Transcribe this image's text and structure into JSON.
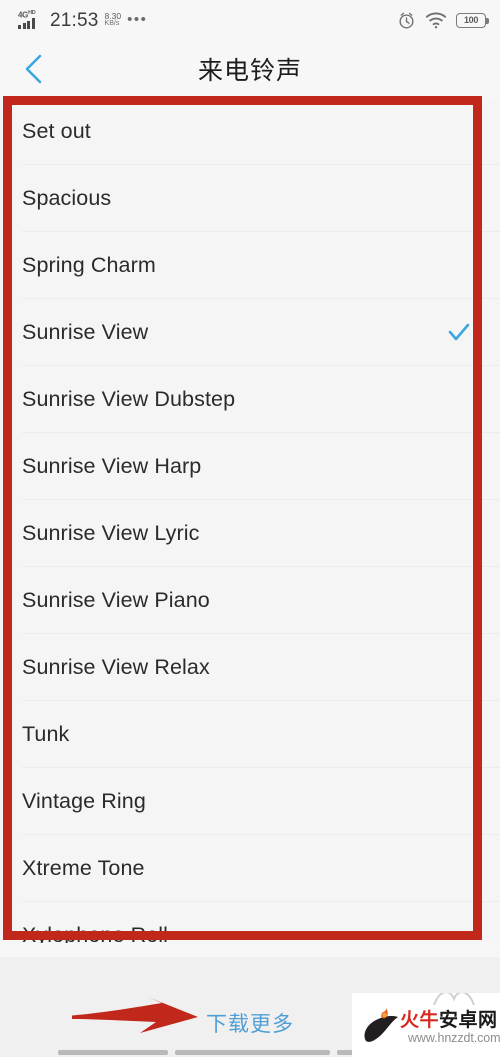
{
  "status_bar": {
    "network_type": "4G",
    "network_suffix": "HD",
    "time": "21:53",
    "net_speed_value": "8.30",
    "net_speed_unit": "KB/s",
    "more_dots": "•••",
    "alarm_icon": "alarm-clock-icon",
    "wifi_icon": "wifi-icon",
    "battery_level": "100"
  },
  "header": {
    "back_icon": "back-chevron-icon",
    "title": "来电铃声"
  },
  "list": {
    "selected": "Sunrise View",
    "check_icon": "checkmark-icon",
    "items": [
      {
        "label": "Set out",
        "checked": false
      },
      {
        "label": "Spacious",
        "checked": false
      },
      {
        "label": "Spring Charm",
        "checked": false
      },
      {
        "label": "Sunrise View",
        "checked": true
      },
      {
        "label": "Sunrise View Dubstep",
        "checked": false
      },
      {
        "label": "Sunrise View Harp",
        "checked": false
      },
      {
        "label": "Sunrise View Lyric",
        "checked": false
      },
      {
        "label": "Sunrise View Piano",
        "checked": false
      },
      {
        "label": "Sunrise View Relax",
        "checked": false
      },
      {
        "label": "Tunk",
        "checked": false
      },
      {
        "label": "Vintage Ring",
        "checked": false
      },
      {
        "label": "Xtreme Tone",
        "checked": false
      },
      {
        "label": "Xylophone Roll",
        "checked": false
      }
    ]
  },
  "footer": {
    "download_more": "下载更多"
  },
  "annotations": {
    "box_color": "#c1271b",
    "arrow_color": "#c1271b",
    "arrow_icon": "red-arrow-icon",
    "box_icon": "red-highlight-box"
  },
  "watermark": {
    "name_red": "火牛",
    "name_black": "安卓网",
    "url": "www.hnzzdt.com",
    "logo_icon": "bull-flame-logo-icon"
  },
  "nav_bar": {
    "back_key": "nav-back",
    "home_key": "nav-home",
    "recents_key": "nav-recents"
  },
  "colors": {
    "accent_blue": "#4f9fd6",
    "annotation_red": "#c1271b",
    "list_bg": "#f5f5f5"
  }
}
